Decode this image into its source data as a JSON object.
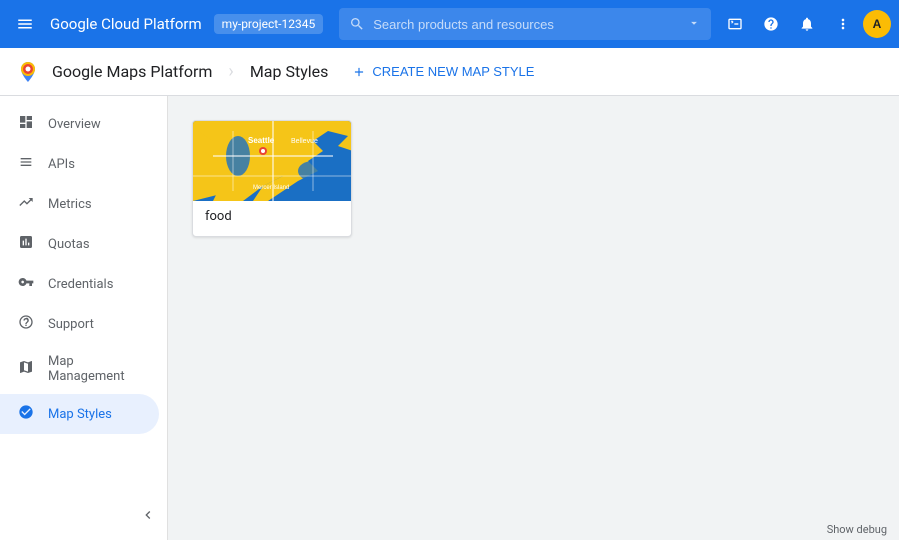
{
  "topbar": {
    "title": "Google Cloud Platform",
    "project": "my-project-12345",
    "search_placeholder": "Search products and resources"
  },
  "subheader": {
    "app_name": "Google Maps Platform",
    "page_title": "Map Styles",
    "create_btn_label": "CREATE NEW MAP STYLE"
  },
  "sidebar": {
    "items": [
      {
        "id": "overview",
        "label": "Overview",
        "icon": "⊙"
      },
      {
        "id": "apis",
        "label": "APIs",
        "icon": "≡"
      },
      {
        "id": "metrics",
        "label": "Metrics",
        "icon": "⋮"
      },
      {
        "id": "quotas",
        "label": "Quotas",
        "icon": "▭"
      },
      {
        "id": "credentials",
        "label": "Credentials",
        "icon": "⚷"
      },
      {
        "id": "support",
        "label": "Support",
        "icon": "👤"
      },
      {
        "id": "map-management",
        "label": "Map Management",
        "icon": "🗺"
      },
      {
        "id": "map-styles",
        "label": "Map Styles",
        "icon": "⊕",
        "active": true
      }
    ]
  },
  "main": {
    "cards": [
      {
        "id": "food",
        "label": "food"
      }
    ]
  },
  "bottom": {
    "debug_label": "Show debug"
  },
  "colors": {
    "accent": "#1a73e8",
    "active_bg": "#e8f0fe",
    "active_text": "#1a73e8"
  }
}
